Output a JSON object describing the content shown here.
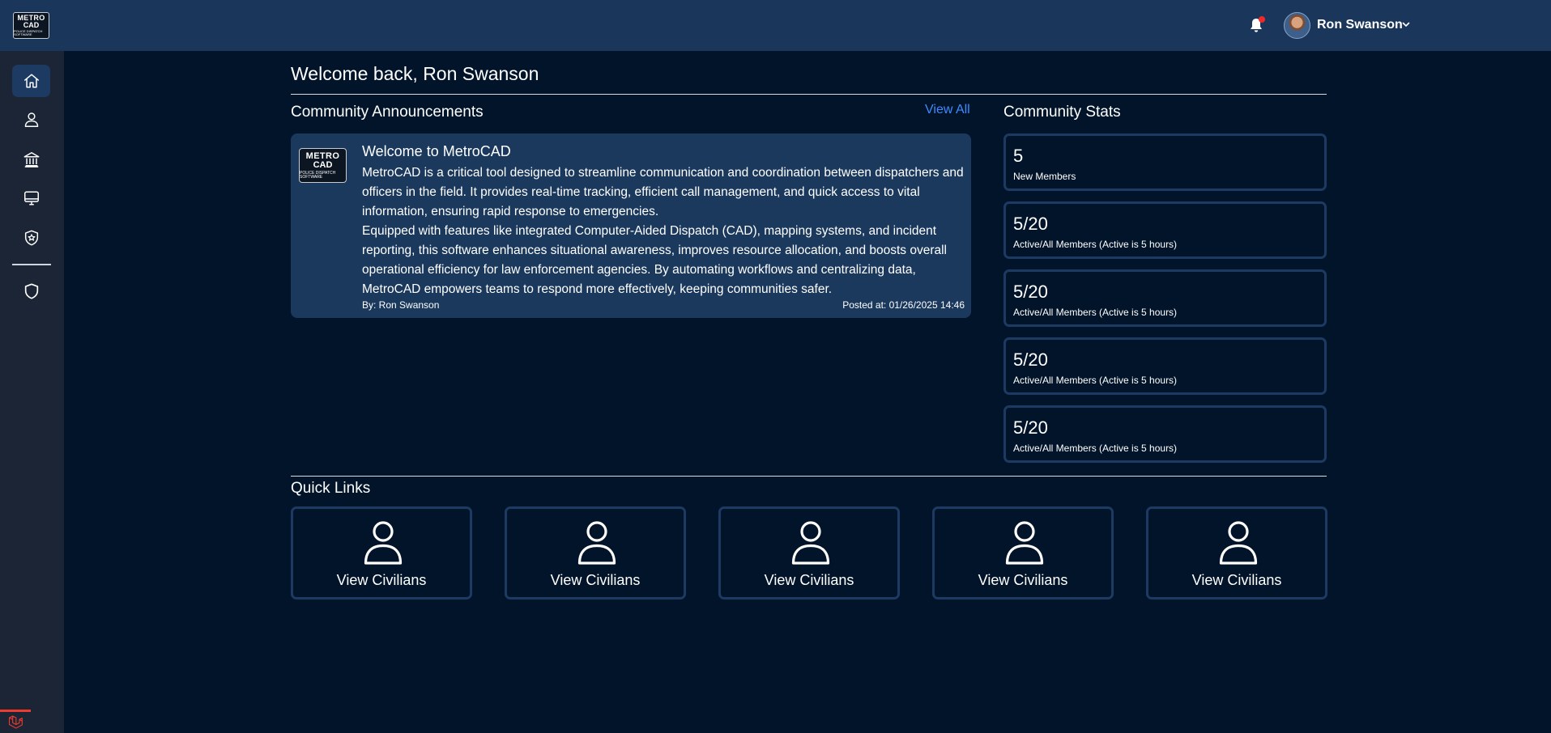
{
  "header": {
    "logo": {
      "line1": "METRO",
      "line2": "CAD",
      "line3": "POLICE DISPATCH SOFTWARE"
    },
    "user": {
      "name": "Ron Swanson"
    },
    "icons": {
      "notifications": "bell-icon",
      "menu": "chevron-down-icon"
    },
    "colors": {
      "bar": "#1a365a",
      "notification_dot": "#ef2a2a"
    }
  },
  "sidebar": {
    "items": [
      {
        "icon": "home-icon",
        "active": true
      },
      {
        "icon": "user-icon",
        "active": false
      },
      {
        "icon": "bank-icon",
        "active": false
      },
      {
        "icon": "monitor-icon",
        "active": false
      },
      {
        "icon": "police-badge-icon",
        "active": false
      },
      {
        "icon": "shield-icon",
        "active": false
      }
    ],
    "footer_icon": "laravel-icon"
  },
  "main": {
    "welcome": "Welcome back, Ron Swanson",
    "announcements": {
      "title": "Community Announcements",
      "view_all": "View All",
      "items": [
        {
          "logo": {
            "line1": "METRO",
            "line2": "CAD",
            "line3": "POLICE DISPATCH SOFTWARE"
          },
          "title": "Welcome to MetroCAD",
          "paragraph1": "MetroCAD is a critical tool designed to streamline communication and coordination between dispatchers and officers in the field. It provides real-time tracking, efficient call management, and quick access to vital information, ensuring rapid response to emergencies.",
          "paragraph2": "Equipped with features like integrated Computer-Aided Dispatch (CAD), mapping systems, and incident reporting, this software enhances situational awareness, improves resource allocation, and boosts overall operational efficiency for law enforcement agencies. By automating workflows and centralizing data, MetroCAD empowers teams to respond more effectively, keeping communities safer.",
          "by": "By: Ron Swanson",
          "posted": "Posted at: 01/26/2025 14:46"
        }
      ]
    },
    "stats": {
      "title": "Community Stats",
      "items": [
        {
          "value": "5",
          "label": "New Members"
        },
        {
          "value": "5/20",
          "label": "Active/All Members (Active is 5 hours)"
        },
        {
          "value": "5/20",
          "label": "Active/All Members (Active is 5 hours)"
        },
        {
          "value": "5/20",
          "label": "Active/All Members (Active is 5 hours)"
        },
        {
          "value": "5/20",
          "label": "Active/All Members (Active is 5 hours)"
        }
      ]
    },
    "quick_links": {
      "title": "Quick Links",
      "items": [
        {
          "icon": "user-icon",
          "label": "View Civilians"
        },
        {
          "icon": "user-icon",
          "label": "View Civilians"
        },
        {
          "icon": "user-icon",
          "label": "View Civilians"
        },
        {
          "icon": "user-icon",
          "label": "View Civilians"
        },
        {
          "icon": "user-icon",
          "label": "View Civilians"
        }
      ]
    },
    "colors": {
      "background": "#01142a",
      "card": "#1b395d",
      "border": "#1d3a62",
      "link": "#3d8bff"
    }
  }
}
